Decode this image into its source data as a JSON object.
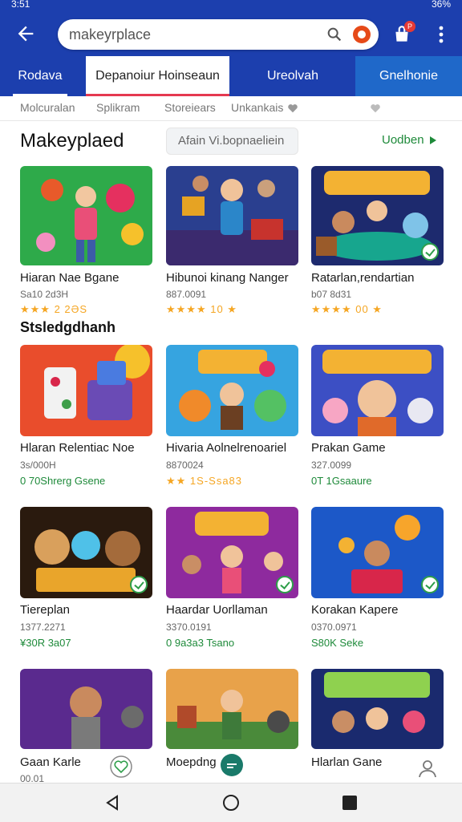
{
  "status_bar": {
    "time": "3:51",
    "battery": "36%"
  },
  "app_bar": {
    "search_text": "makeyrplace",
    "icons": [
      "back-arrow-icon",
      "search-icon",
      "app-logo-icon",
      "cart-icon",
      "more-vert-icon"
    ],
    "cart_badge": "P"
  },
  "tabs": [
    {
      "label": "Rodava"
    },
    {
      "label": "Depanoiur Hoinseaun"
    },
    {
      "label": "Ureolvah"
    },
    {
      "label": "Gnelhonie"
    }
  ],
  "filters": [
    "Molcuralan",
    "Splikram",
    "Storeiears",
    "Unkankais"
  ],
  "section": {
    "title": "Makeyplaed",
    "filter_placeholder": "Afain Vi.bopnaeliein",
    "update_link": "Uodben"
  },
  "subheading": "Stsledgdhanh",
  "cards": [
    {
      "name": "Hiaran Nae Bgane",
      "price": "Sa10 2d3H",
      "rating": "★★★ 2 2ƏS",
      "rating_style": "stars"
    },
    {
      "name": "Hibunoi kinang Nanger",
      "price": "887.0091",
      "rating": "★★★★ 10 ★",
      "rating_style": "stars"
    },
    {
      "name": "Ratarlan,rendartian",
      "price": "b07 8d31",
      "rating": "★★★★ 00 ★",
      "rating_style": "stars"
    },
    {
      "name": "Hlaran Relentiac Noe",
      "price": "3s/000H",
      "rating": "0 70Shrerg Gsene",
      "rating_style": "green"
    },
    {
      "name": "Hivaria Aolnelrenoariel",
      "price": "8870024",
      "rating": "★★ 1S-Ssa83",
      "rating_style": "stars"
    },
    {
      "name": "Prakan Game",
      "price": "327.0099",
      "rating": "0T 1Gsaaure",
      "rating_style": "green"
    },
    {
      "name": "Tiereplan",
      "price": "1377.2271",
      "rating": "¥30R 3a07",
      "rating_style": "green"
    },
    {
      "name": "Haardar Uorllaman",
      "price": "3370.0191",
      "rating": "0 9a3a3 Tsano",
      "rating_style": "green"
    },
    {
      "name": "Korakan Kapere",
      "price": "0370.0971",
      "rating": "S80K Seke",
      "rating_style": "green"
    },
    {
      "name": "Gaan Karle",
      "price": "00.01",
      "rating": "",
      "rating_style": "green"
    },
    {
      "name": "Moepdng",
      "price": "",
      "rating": "",
      "rating_style": "green"
    },
    {
      "name": "Hlarlan Gane",
      "price": "",
      "rating": "",
      "rating_style": "green"
    }
  ],
  "colors": {
    "primary": "#1c3fae",
    "accent_tab": "#1f68c9",
    "green": "#1e8a3a",
    "star": "#f5a623",
    "red": "#e53950"
  }
}
